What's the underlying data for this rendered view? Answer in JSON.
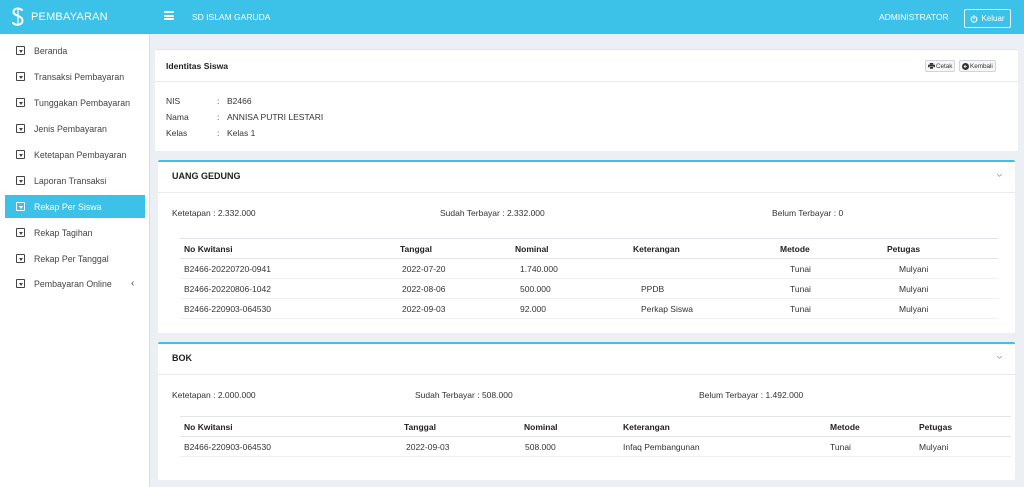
{
  "header": {
    "brand": "PEMBAYARAN",
    "school": "SD ISLAM GARUDA",
    "user": "ADMINISTRATOR",
    "logout_label": "Keluar",
    "accent": "#3cc1e8"
  },
  "sidebar": {
    "items": [
      {
        "label": "Beranda"
      },
      {
        "label": "Transaksi Pembayaran"
      },
      {
        "label": "Tunggakan Pembayaran"
      },
      {
        "label": "Jenis Pembayaran"
      },
      {
        "label": "Ketetapan Pembayaran"
      },
      {
        "label": "Laporan Transaksi"
      },
      {
        "label": "Rekap Per Siswa",
        "active": true
      },
      {
        "label": "Rekap Tagihan"
      },
      {
        "label": "Rekap Per Tanggal"
      },
      {
        "label": "Pembayaran Online",
        "chevron": "‹"
      }
    ]
  },
  "identity": {
    "title": "Identitas Siswa",
    "print_label": "Cetak",
    "back_label": "Kembali",
    "fields": [
      {
        "label": "NIS",
        "sep": ":",
        "value": "B2466"
      },
      {
        "label": "Nama",
        "sep": ":",
        "value": "ANNISA PUTRI LESTARI"
      },
      {
        "label": "Kelas",
        "sep": ":",
        "value": "Kelas 1"
      }
    ]
  },
  "sections": [
    {
      "title": "UANG GEDUNG",
      "ketetapan": "Ketetapan : 2.332.000",
      "sudah": "Sudah Terbayar : 2.332.000",
      "belum": "Belum Terbayar : 0",
      "columns": [
        "No Kwitansi",
        "Tanggal",
        "Nominal",
        "Keterangan",
        "Metode",
        "Petugas"
      ],
      "rows": [
        [
          "B2466-20220720-0941",
          "2022-07-20",
          "1.740.000",
          "",
          "Tunai",
          "Mulyani"
        ],
        [
          "B2466-20220806-1042",
          "2022-08-06",
          "500.000",
          "PPDB",
          "Tunai",
          "Mulyani"
        ],
        [
          "B2466-220903-064530",
          "2022-09-03",
          "92.000",
          "Perkap Siswa",
          "Tunai",
          "Mulyani"
        ]
      ]
    },
    {
      "title": "BOK",
      "ketetapan": "Ketetapan : 2.000.000",
      "sudah": "Sudah Terbayar : 508.000",
      "belum": "Belum Terbayar : 1.492.000",
      "columns": [
        "No Kwitansi",
        "Tanggal",
        "Nominal",
        "Keterangan",
        "Metode",
        "Petugas"
      ],
      "rows": [
        [
          "B2466-220903-064530",
          "2022-09-03",
          "508.000",
          "Infaq Pembangunan",
          "Tunai",
          "Mulyani"
        ]
      ]
    }
  ]
}
